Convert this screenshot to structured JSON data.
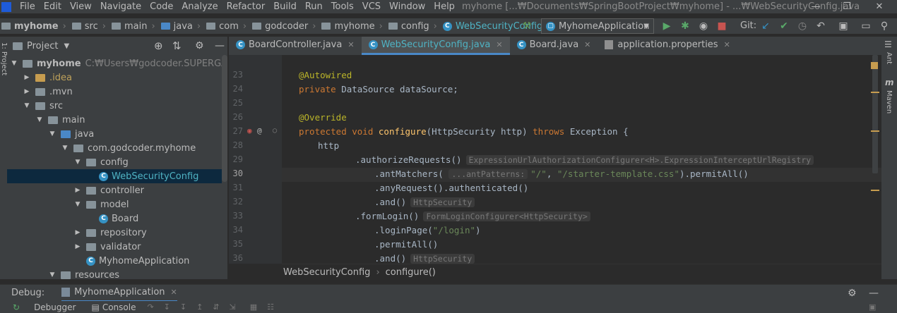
{
  "menubar": {
    "items": [
      "File",
      "Edit",
      "View",
      "Navigate",
      "Code",
      "Analyze",
      "Refactor",
      "Build",
      "Run",
      "Tools",
      "VCS",
      "Window",
      "Help"
    ],
    "window_title": "myhome [...₩Documents₩SpringBootProject₩myhome] - ...₩WebSecurityConfig.java"
  },
  "navbar": {
    "crumbs": [
      "myhome",
      "src",
      "main",
      "java",
      "com",
      "godcoder",
      "myhome",
      "config",
      "WebSecurityConfig"
    ],
    "run_config": "MyhomeApplication",
    "git_label": "Git:"
  },
  "project": {
    "title": "Project",
    "root_name": "myhome",
    "root_path": "C:₩Users₩godcoder.SUPERGAME₩Doc",
    "tree": [
      {
        "label": ".idea",
        "indent": 1,
        "arrow": "right",
        "icon": "folder-orange"
      },
      {
        "label": ".mvn",
        "indent": 1,
        "arrow": "right",
        "icon": "folder"
      },
      {
        "label": "src",
        "indent": 1,
        "arrow": "down",
        "icon": "folder"
      },
      {
        "label": "main",
        "indent": 2,
        "arrow": "down",
        "icon": "folder"
      },
      {
        "label": "java",
        "indent": 3,
        "arrow": "down",
        "icon": "folder-blue"
      },
      {
        "label": "com.godcoder.myhome",
        "indent": 4,
        "arrow": "down",
        "icon": "package"
      },
      {
        "label": "config",
        "indent": 5,
        "arrow": "down",
        "icon": "package"
      },
      {
        "label": "WebSecurityConfig",
        "indent": 6,
        "arrow": "none",
        "icon": "class",
        "selected": true
      },
      {
        "label": "controller",
        "indent": 5,
        "arrow": "right",
        "icon": "package"
      },
      {
        "label": "model",
        "indent": 5,
        "arrow": "down",
        "icon": "package"
      },
      {
        "label": "Board",
        "indent": 6,
        "arrow": "none",
        "icon": "class"
      },
      {
        "label": "repository",
        "indent": 5,
        "arrow": "right",
        "icon": "package"
      },
      {
        "label": "validator",
        "indent": 5,
        "arrow": "right",
        "icon": "package"
      },
      {
        "label": "MyhomeApplication",
        "indent": 5,
        "arrow": "none",
        "icon": "class"
      },
      {
        "label": "resources",
        "indent": 3,
        "arrow": "down",
        "icon": "folder"
      }
    ]
  },
  "tabs": [
    {
      "label": "BoardController.java",
      "active": false
    },
    {
      "label": "WebSecurityConfig.java",
      "active": true
    },
    {
      "label": "Board.java",
      "active": false
    },
    {
      "label": "application.properties",
      "active": false
    }
  ],
  "editor": {
    "lines": [
      "23",
      "24",
      "25",
      "26",
      "27",
      "28",
      "29",
      "30",
      "31",
      "32",
      "33",
      "34",
      "35",
      "36"
    ],
    "code": {
      "l23": "@Autowired",
      "l24_kw": "private",
      "l24_rest": " DataSource dataSource;",
      "l26": "@Override",
      "l27_kw1": "protected void",
      "l27_fn": "configure",
      "l27_mid": "(HttpSecurity http) ",
      "l27_kw2": "throws",
      "l27_end": " Exception {",
      "l28": "http",
      "l29": ".authorizeRequests()",
      "l29_hint": "ExpressionUrlAuthorizationConfigurer<H>.ExpressionInterceptUrlRegistry",
      "l30_pre": ".antMatchers(",
      "l30_hint": "...antPatterns:",
      "l30_s1": "\"/\"",
      "l30_comma": ", ",
      "l30_s2": "\"/starter-template.css\"",
      "l30_post": ").permitAll()",
      "l31": ".anyRequest().authenticated()",
      "l32": ".and()",
      "l32_hint": "HttpSecurity",
      "l33": ".formLogin()",
      "l33_hint": "FormLoginConfigurer<HttpSecurity>",
      "l34_pre": ".loginPage(",
      "l34_str": "\"/login\"",
      "l34_post": ")",
      "l35": ".permitAll()",
      "l36": ".and()",
      "l36_hint": "HttpSecurity"
    },
    "breadcrumb_class": "WebSecurityConfig",
    "breadcrumb_method": "configure()"
  },
  "right_stripe": {
    "ant": "Ant",
    "maven": "Maven"
  },
  "left_stripe": {
    "project": "1: Project"
  },
  "debug": {
    "label": "Debug:",
    "config": "MyhomeApplication",
    "tabs": [
      "Debugger",
      "Console"
    ]
  },
  "colors": {
    "accent": "#4a88c7",
    "keyword": "#cc7832",
    "annotation": "#bbb529",
    "string": "#6a8759",
    "method": "#ffc66d"
  }
}
